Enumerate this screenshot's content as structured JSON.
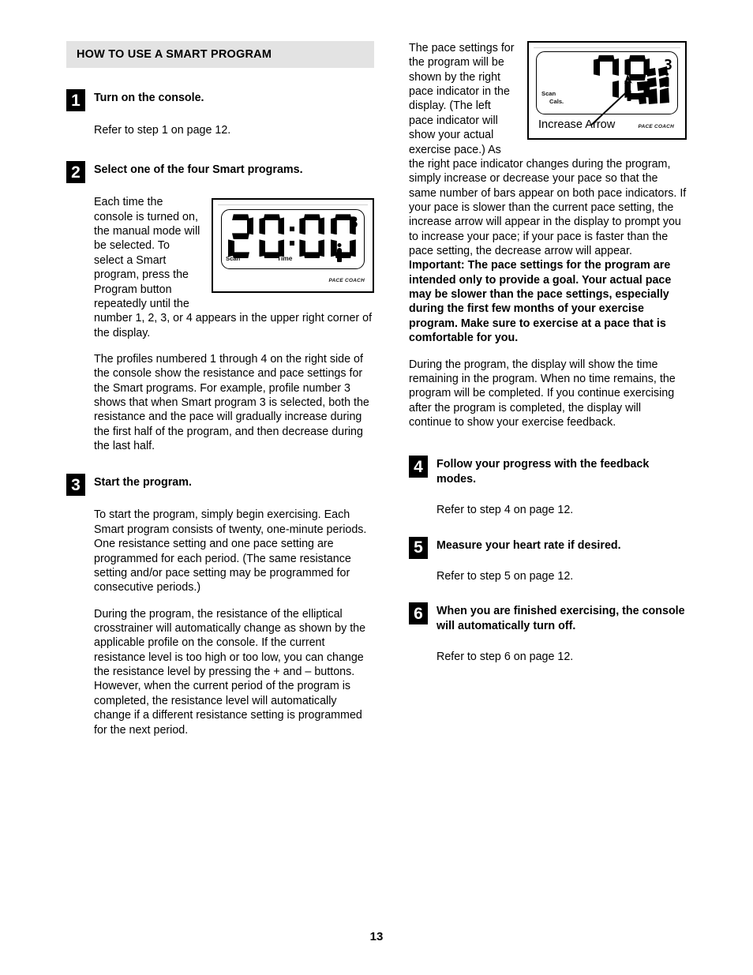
{
  "section": {
    "heading": "HOW TO USE A SMART PROGRAM"
  },
  "steps": [
    {
      "number": "1",
      "heading": "Turn on the console.",
      "body": [
        "Refer to step 1 on page 12."
      ]
    },
    {
      "number": "2",
      "heading": "Select one of the four Smart programs.",
      "body": [
        "Each time the console is turned on, the manual mode will be selected. To select a Smart program, press the Program button repeatedly until the number 1, 2, 3, or 4 appears in the upper right corner of the display.",
        "The profiles numbered 1 through 4 on the right side of the console show the resistance and pace settings for the Smart programs. For example, profile number 3 shows that when Smart program 3 is selected, both the resistance and the pace will gradually increase during the first half of the program, and then decrease during the last half."
      ]
    },
    {
      "number": "3",
      "heading": "Start the program.",
      "body": [
        "To start the program, simply begin exercising. Each Smart program consists of twenty, one-minute periods. One resistance setting and one pace setting are programmed for each period. (The same resistance setting and/or pace setting may be programmed for consecutive periods.)",
        "During the program, the resistance of the elliptical crosstrainer will automatically change as shown by the applicable profile on the console. If the current resistance level is too high or too low, you can change the resistance level by pressing the + and – buttons. However, when the current period of the program is completed, the resistance level will automatically change if a different resistance setting is programmed for the next period."
      ]
    },
    {
      "number": "4",
      "heading": "Follow your progress with the feedback modes.",
      "body": [
        "Refer to step 4 on page 12."
      ]
    },
    {
      "number": "5",
      "heading": "Measure your heart rate if desired.",
      "body": [
        "Refer to step 5 on page 12."
      ]
    },
    {
      "number": "6",
      "heading": "When you are finished exercising, the console will automatically turn off.",
      "body": [
        "Refer to step 6 on page 12."
      ]
    }
  ],
  "right_column": {
    "paragraph_wrap": "The pace settings for the program will be shown by the right pace indicator in the display. (The left pace indicator will show your actual exercise pace.) As the right pace indicator changes during the program, simply increase or decrease your pace so that the same number of bars appear on both pace indicators. If your pace is slower than the current pace setting, the increase arrow will appear in the display to prompt you to increase your pace; if your pace is faster than the pace setting, the decrease arrow will appear. ",
    "important_bold": "Important: The pace settings for the program are intended only to provide a goal. Your actual pace may be slower than the pace settings, especially during the first few months of your exercise program. Make sure to exercise at a pace that is comfortable for you.",
    "paragraph_after": "During the program, the display will show the time remaining in the program. When no time remains, the program will be completed. If you continue exercising after the program is completed, the display will continue to show your exercise feedback."
  },
  "figure_time_display": {
    "digits": "20:00",
    "program_number": "3",
    "scan_label": "Scan",
    "mode_label": "Time",
    "brand_label": "PACE COACH",
    "person_icon": "person-icon"
  },
  "figure_pace_display": {
    "digits": "78",
    "program_number": "3",
    "scan_label": "Scan",
    "cals_label": "Cals.",
    "brand_label": "PACE COACH",
    "callout_label": "Increase Arrow",
    "person_icon": "person-icon",
    "arrow_icon": "up-arrow-icon"
  },
  "footer": {
    "page_number": "13"
  }
}
